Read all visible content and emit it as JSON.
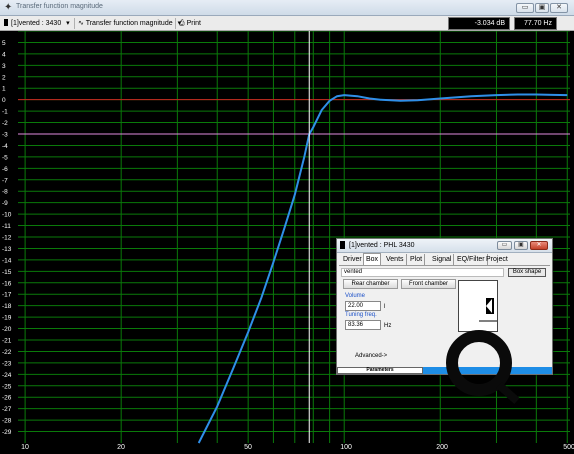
{
  "window": {
    "title": "Transfer function magnitude",
    "minimize": "▭",
    "maximize": "▣",
    "close": "✕"
  },
  "toolbar": {
    "driver_select": "[1]vented : 3430",
    "view_select": "Transfer function magnitude",
    "print_label": "Print",
    "level_readout": "-3.034 dB",
    "freq_readout": "77.70 Hz"
  },
  "chart_data": {
    "type": "line",
    "xscale": "log",
    "xlim": [
      9.5,
      510
    ],
    "ylim": [
      -30,
      6
    ],
    "x_tick_labels": [
      "10",
      "20",
      "50",
      "100",
      "200",
      "500"
    ],
    "y_tick_labels": [
      "5",
      "4",
      "3",
      "2",
      "1",
      "0",
      "-1",
      "-2",
      "-3",
      "-4",
      "-5",
      "-6",
      "-7",
      "-8",
      "-9",
      "-10",
      "-11",
      "-12",
      "-13",
      "-14",
      "-15",
      "-16",
      "-17",
      "-18",
      "-19",
      "-20",
      "-21",
      "-22",
      "-23",
      "-24",
      "-25",
      "-26",
      "-27",
      "-28",
      "-29"
    ],
    "grid": true,
    "reference_lines": [
      {
        "y": 0,
        "color": "#cc2222"
      },
      {
        "y": -3,
        "color": "#e28ce0"
      }
    ],
    "cursor": {
      "x": 77.7,
      "y": -3.034,
      "color": "#ffffff"
    },
    "series": [
      {
        "color": "#2f8fe8",
        "x": [
          35,
          40,
          45,
          50,
          55,
          60,
          65,
          70,
          75,
          77.7,
          80,
          85,
          90,
          95,
          100,
          110,
          120,
          130,
          150,
          170,
          200,
          250,
          300,
          350,
          400,
          450,
          500
        ],
        "y": [
          -30,
          -26.8,
          -23.4,
          -20.3,
          -17.3,
          -14.2,
          -11.2,
          -8.3,
          -5.0,
          -3.03,
          -2.4,
          -0.9,
          -0.1,
          0.3,
          0.4,
          0.3,
          0.1,
          0.0,
          -0.1,
          -0.05,
          0.1,
          0.3,
          0.4,
          0.45,
          0.45,
          0.42,
          0.4
        ]
      }
    ]
  },
  "params_window": {
    "title": "[1]vented : PHL 3430",
    "tabs": [
      "Driver",
      "Box",
      "Vents",
      "Plot",
      "Signal",
      "EQ/Filter",
      "Project"
    ],
    "active_tab": "Box",
    "box_type": "vented",
    "box_shape_button": "Box shape",
    "rear_chamber_button": "Rear chamber",
    "front_chamber_button": "Front chamber",
    "volume_label": "Volume",
    "volume_value": "22.00",
    "volume_unit": "l",
    "tuning_label": "Tuning freq.",
    "tuning_value": "83.36",
    "tuning_unit": "Hz",
    "advanced_label": "Advanced->",
    "footer_label": "Parameters"
  }
}
